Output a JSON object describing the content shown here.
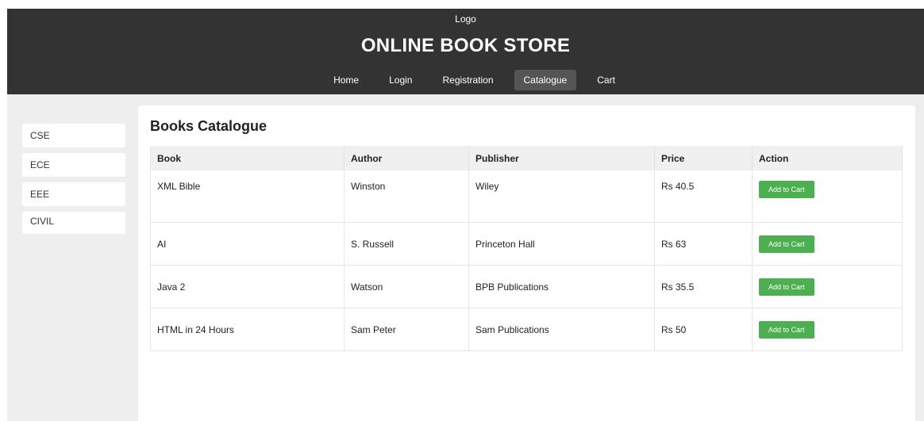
{
  "header": {
    "logo": "Logo",
    "title": "ONLINE BOOK STORE",
    "nav": [
      {
        "label": "Home"
      },
      {
        "label": "Login"
      },
      {
        "label": "Registration"
      },
      {
        "label": "Catalogue",
        "active": true
      },
      {
        "label": "Cart"
      }
    ]
  },
  "sidebar": {
    "items": [
      {
        "label": "CSE"
      },
      {
        "label": "ECE"
      },
      {
        "label": "EEE"
      },
      {
        "label": "CIVIL"
      }
    ]
  },
  "catalogue": {
    "title": "Books Catalogue",
    "columns": [
      "Book",
      "Author",
      "Publisher",
      "Price",
      "Action"
    ],
    "rows": [
      {
        "book": "XML Bible",
        "author": "Winston",
        "publisher": "Wiley",
        "price": "Rs 40.5",
        "action": "Add to Cart"
      },
      {
        "book": "AI",
        "author": "S. Russell",
        "publisher": "Princeton Hall",
        "price": "Rs 63",
        "action": "Add to Cart"
      },
      {
        "book": "Java 2",
        "author": "Watson",
        "publisher": "BPB Publications",
        "price": "Rs 35.5",
        "action": "Add to Cart"
      },
      {
        "book": "HTML in 24 Hours",
        "author": "Sam Peter",
        "publisher": "Sam Publications",
        "price": "Rs 50",
        "action": "Add to Cart"
      }
    ]
  },
  "colors": {
    "header_bg": "#333333",
    "nav_active_bg": "#555555",
    "button_green": "#4caf50",
    "page_bg": "#eeeeee"
  }
}
